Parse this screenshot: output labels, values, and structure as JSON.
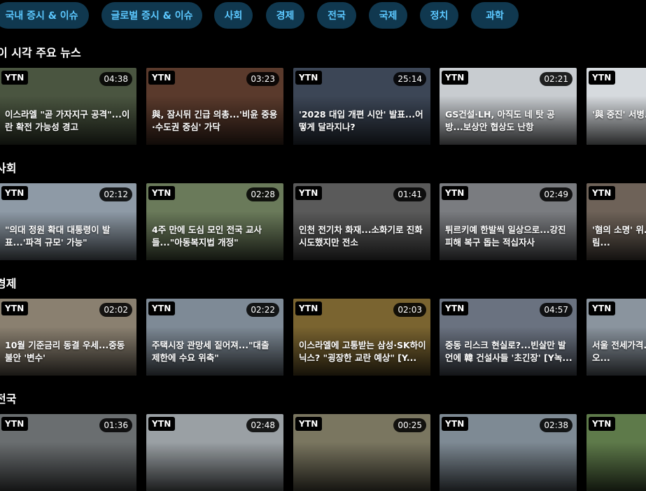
{
  "categories": [
    "국내 증시 & 이슈",
    "글로벌 증시 & 이슈",
    "사회",
    "경제",
    "전국",
    "국제",
    "정치",
    "과학"
  ],
  "colors": {
    "background": "#000000",
    "category_bg": "#10384f",
    "category_text": "#5cc8ff"
  },
  "badge_label": "YTN",
  "sections": [
    {
      "title": "이 시각 주요 뉴스",
      "videos": [
        {
          "duration": "04:38",
          "title": "이스라엘 \"곧 가자지구 공격\"...이란 확전 가능성 경고",
          "thumb": "#4a5540"
        },
        {
          "duration": "03:23",
          "title": "與, 잠시뒤 긴급 의총...'비윤 중용·수도권 중심' 가닥",
          "thumb": "#5a3a2c"
        },
        {
          "duration": "25:14",
          "title": "'2028 대입 개편 시안' 발표...어떻게 달라지나?",
          "thumb": "#3c4656"
        },
        {
          "duration": "02:21",
          "title": "GS건설·LH, 아직도 네 탓 공방...보상안 협상도 난항",
          "thumb": "#c8ccd0"
        },
        {
          "duration": "",
          "title": "'與 중진' 서병... 자리 버거워\"...",
          "thumb": "#d6dade"
        }
      ]
    },
    {
      "title": "사회",
      "videos": [
        {
          "duration": "02:12",
          "title": "\"의대 정원 확대 대통령이 발표...'파격 규모' 가능\"",
          "thumb": "#8e9aa6"
        },
        {
          "duration": "02:28",
          "title": "4주 만에 도심 모인 전국 교사들...\"아동복지법 개정\"",
          "thumb": "#6a7a5a"
        },
        {
          "duration": "01:41",
          "title": "인천 전기차 화재...소화기로 진화 시도했지만 전소",
          "thumb": "#5a5a5a"
        },
        {
          "duration": "02:49",
          "title": "튀르키예 한발씩 일상으로...강진 피해 복구 돕는 적십자사",
          "thumb": "#7a7c80"
        },
        {
          "duration": "",
          "title": "'혐의 소명' 위... 뤄...검찰 노림...",
          "thumb": "#6e6258"
        }
      ]
    },
    {
      "title": "경제",
      "videos": [
        {
          "duration": "02:02",
          "title": "10월 기준금리 동결 우세...중동 불안 '변수'",
          "thumb": "#8a8070"
        },
        {
          "duration": "02:22",
          "title": "주택시장 관망세 짙어져...\"대출 제한에 수요 위축\"",
          "thumb": "#7e8a96"
        },
        {
          "duration": "02:03",
          "title": "이스라엘에 고통받는 삼성·SK하이닉스? \"굉장한 교란 예상\" [Y...",
          "thumb": "#7a6430"
        },
        {
          "duration": "04:57",
          "title": "중동 리스크 현실로?...빈살만 발언에 韓 건설사들 '초긴장' [Y녹...",
          "thumb": "#6a7280"
        },
        {
          "duration": "",
          "title": "서울 전세가격... 세...\"당분간 오...",
          "thumb": "#8a949e"
        }
      ]
    },
    {
      "title": "전국",
      "videos": [
        {
          "duration": "01:36",
          "title": "",
          "thumb": "#6a6e70"
        },
        {
          "duration": "02:48",
          "title": "",
          "thumb": "#9aa0a4"
        },
        {
          "duration": "00:25",
          "title": "",
          "thumb": "#7a7660"
        },
        {
          "duration": "02:38",
          "title": "",
          "thumb": "#7e8a94"
        },
        {
          "duration": "",
          "title": "",
          "thumb": "#5e7a4a"
        }
      ]
    }
  ]
}
